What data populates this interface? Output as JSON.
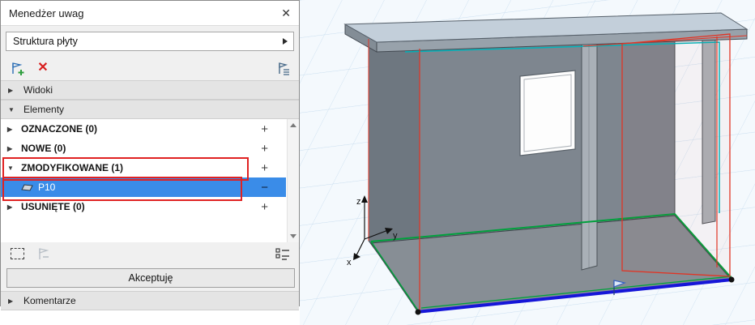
{
  "colors": {
    "selection_blue": "#3a8ce8",
    "annotation_box_red": "#e02222",
    "modified_outline_red": "#e13424",
    "new_outline_green": "#00a03c",
    "reference_teal": "#00b3ba",
    "bottom_edge_blue": "#1616d8",
    "grid_blue": "#cbdff0"
  },
  "panel": {
    "title": "Menedżer uwag",
    "close_glyph": "✕",
    "scheme_dropdown": {
      "value": "Struktura płyty"
    },
    "toolbar": {
      "delete_glyph": "✕"
    },
    "sections": {
      "views": {
        "label": "Widoki",
        "arrow": "▶"
      },
      "elements": {
        "label": "Elementy",
        "arrow": "▼"
      },
      "comments": {
        "label": "Komentarze",
        "arrow": "▶"
      }
    },
    "rows": [
      {
        "label": "OZNACZONE (0)",
        "arrow": "▶",
        "action": "+"
      },
      {
        "label": "NOWE (0)",
        "arrow": "▶",
        "action": "+"
      },
      {
        "label": "ZMODYFIKOWANE (1)",
        "arrow": "▼",
        "action": "+"
      },
      {
        "label": "P10",
        "arrow": "",
        "action": "−"
      },
      {
        "label": "USUNIĘTE (0)",
        "arrow": "▶",
        "action": "+"
      }
    ],
    "accept_button_label": "Akceptuję"
  },
  "viewport": {
    "axis_labels": {
      "x": "x",
      "y": "y",
      "z": "z"
    }
  },
  "icons": {
    "add_markup": "flag-plus",
    "delete_markup": "x-mark",
    "markup_report": "flag-list",
    "marquee": "dashed-rectangle",
    "apply_markup": "flag-arrow-disabled",
    "options": "checklist",
    "slab_item": "slab",
    "flag_marker": "flag"
  }
}
